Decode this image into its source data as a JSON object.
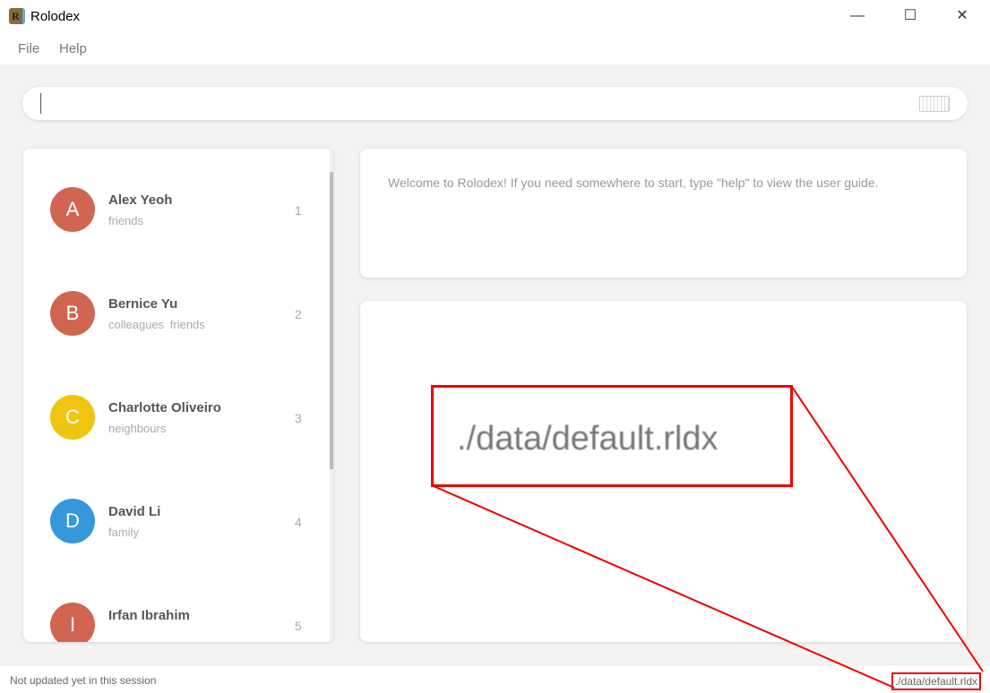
{
  "window": {
    "title": "Rolodex",
    "logo_letter": "R",
    "controls": [
      "minimize",
      "maximize",
      "close"
    ]
  },
  "menu": [
    "File",
    "Help"
  ],
  "command_box": {
    "value": "",
    "placeholder": "",
    "icon": "keyboard-icon"
  },
  "persons": [
    {
      "index": "1",
      "initial": "A",
      "name": "Alex Yeoh",
      "tags": "friends",
      "color": "#d06651"
    },
    {
      "index": "2",
      "initial": "B",
      "name": "Bernice Yu",
      "tags": "colleagues friends",
      "color": "#d06651"
    },
    {
      "index": "3",
      "initial": "C",
      "name": "Charlotte Oliveiro",
      "tags": "neighbours",
      "color": "#f1c40f"
    },
    {
      "index": "4",
      "initial": "D",
      "name": "David Li",
      "tags": "family",
      "color": "#3498db"
    },
    {
      "index": "5",
      "initial": "I",
      "name": "Irfan Ibrahim",
      "tags": "",
      "color": "#d06651"
    }
  ],
  "result": "Welcome to Rolodex! If you need somewhere to start, type \"help\" to view the user guide.",
  "status": {
    "left": "Not updated yet in this session",
    "right": "./data/default.rldx"
  },
  "annotation": {
    "magnified_text": "./data/default.rldx",
    "color": "#e00000"
  }
}
